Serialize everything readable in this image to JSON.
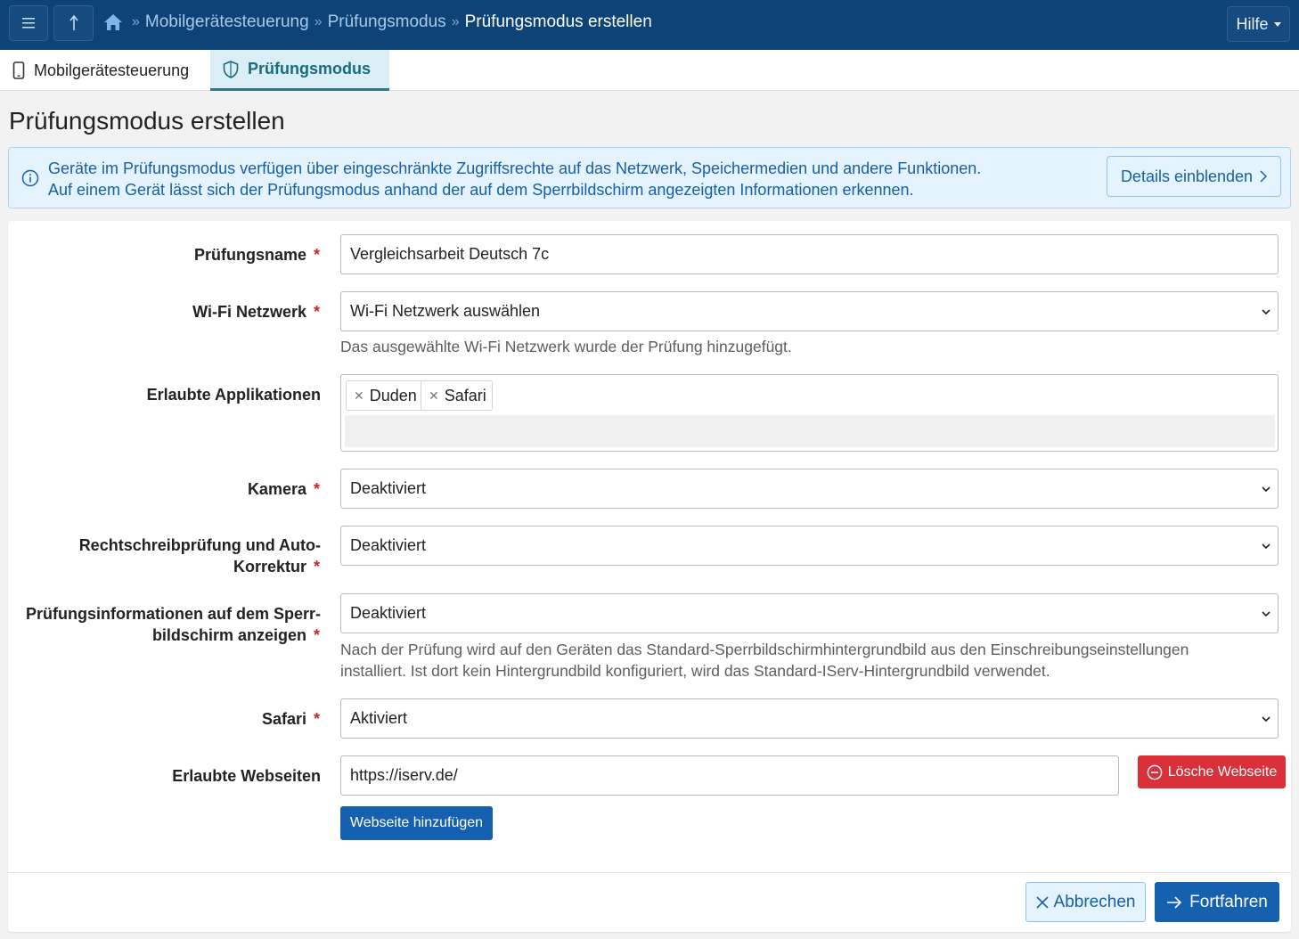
{
  "topbar": {
    "menu_icon": "hamburger-icon",
    "up_icon": "arrow-up-icon",
    "breadcrumb": [
      "Mobilgerätesteuerung",
      "Prüfungsmodus",
      "Prüfungsmodus erstellen"
    ],
    "help_label": "Hilfe"
  },
  "tabs": [
    {
      "label": "Mobilgerätesteuerung",
      "icon": "phone-icon",
      "active": false
    },
    {
      "label": "Prüfungsmodus",
      "icon": "shield-icon",
      "active": true
    }
  ],
  "page": {
    "title": "Prüfungsmodus erstellen"
  },
  "alert": {
    "line1": "Geräte im Prüfungsmodus verfügen über eingeschränkte Zugriffsrechte auf das Netzwerk, Speichermedien und andere Funktionen.",
    "line2": "Auf einem Gerät lässt sich der Prüfungsmodus anhand der auf dem Sperrbildschirm angezeigten Informationen erkennen.",
    "details_label": "Details einblenden"
  },
  "form": {
    "exam_name": {
      "label": "Prüfungsname",
      "value": "Vergleichsarbeit Deutsch 7c"
    },
    "wifi": {
      "label": "Wi-Fi Netzwerk",
      "value": "Wi-Fi Netzwerk auswählen",
      "help": "Das ausgewählte Wi-Fi Netzwerk wurde der Prüfung hinzugefügt."
    },
    "apps": {
      "label": "Erlaubte Applikationen",
      "chips": [
        "Duden",
        "Safari"
      ]
    },
    "camera": {
      "label": "Kamera",
      "value": "Deaktiviert"
    },
    "spellcheck": {
      "label_line1": "Rechtschreibprüfung und Auto-",
      "label_line2": "Korrektur",
      "value": "Deaktiviert"
    },
    "lockscreen": {
      "label_line1": "Prüfungsinformationen auf dem Sperr-",
      "label_line2": "bildschirm anzeigen",
      "value": "Deaktiviert",
      "help_line1": "Nach der Prüfung wird auf den Geräten das Standard-Sperrbildschirmhintergrundbild aus den Einschreibungseinstellungen",
      "help_line2": "installiert. Ist dort kein Hintergrundbild konfiguriert, wird das Standard-IServ-Hintergrundbild verwendet."
    },
    "safari": {
      "label": "Safari",
      "value": "Aktiviert"
    },
    "websites": {
      "label": "Erlaubte Webseiten",
      "value": "https://iserv.de/",
      "delete_label": "Lösche Webseite",
      "add_label": "Webseite hinzufügen"
    },
    "required_mark": "*"
  },
  "footer": {
    "cancel_label": "Abbrechen",
    "continue_label": "Fortfahren"
  },
  "colors": {
    "topbar": "#0e4378",
    "active_tab": "#dbeef5",
    "alert_bg": "#e4f3fd",
    "primary": "#1660b0",
    "danger": "#d9303a"
  }
}
